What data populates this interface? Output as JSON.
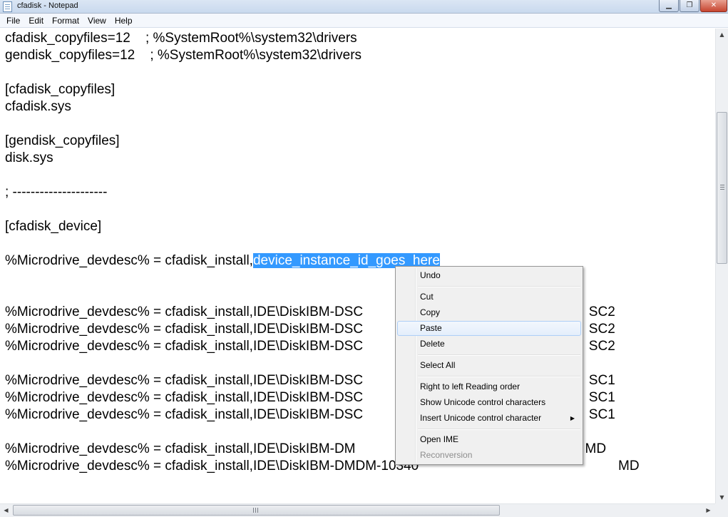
{
  "window": {
    "title": "cfadisk - Notepad",
    "minimize_glyph": "▁",
    "maximize_glyph": "❐",
    "close_glyph": "✕"
  },
  "menubar": {
    "items": [
      "File",
      "Edit",
      "Format",
      "View",
      "Help"
    ]
  },
  "editor": {
    "lines": [
      "cfadisk_copyfiles=12    ; %SystemRoot%\\system32\\drivers",
      "gendisk_copyfiles=12    ; %SystemRoot%\\system32\\drivers",
      "",
      "[cfadisk_copyfiles]",
      "cfadisk.sys",
      "",
      "[gendisk_copyfiles]",
      "disk.sys",
      "",
      "; ---------------------",
      "",
      "[cfadisk_device]",
      "",
      "%Microdrive_devdesc% = cfadisk_install,",
      "",
      "",
      "%Microdrive_devdesc% = cfadisk_install,IDE\\DiskIBM-DSC                                                            SC2",
      "%Microdrive_devdesc% = cfadisk_install,IDE\\DiskIBM-DSC                                                            SC2",
      "%Microdrive_devdesc% = cfadisk_install,IDE\\DiskIBM-DSC                                                            SC2",
      "",
      "%Microdrive_devdesc% = cfadisk_install,IDE\\DiskIBM-DSC                                                            SC1",
      "%Microdrive_devdesc% = cfadisk_install,IDE\\DiskIBM-DSC                                                            SC1",
      "%Microdrive_devdesc% = cfadisk_install,IDE\\DiskIBM-DSC                                                            SC1",
      "",
      "%Microdrive_devdesc% = cfadisk_install,IDE\\DiskIBM-DM                                                             MD",
      "%Microdrive_devdesc% = cfadisk_install,IDE\\DiskIBM-DMDM-10340                                                     MD"
    ],
    "selected_text": "device_instance_id_goes_here"
  },
  "context_menu": {
    "undo": "Undo",
    "cut": "Cut",
    "copy": "Copy",
    "paste": "Paste",
    "delete": "Delete",
    "select_all": "Select All",
    "rtl": "Right to left Reading order",
    "show_unicode": "Show Unicode control characters",
    "insert_unicode": "Insert Unicode control character",
    "open_ime": "Open IME",
    "reconversion": "Reconversion",
    "submenu_glyph": "▶"
  },
  "scrollbars": {
    "up_glyph": "▲",
    "down_glyph": "▼",
    "left_glyph": "◀",
    "right_glyph": "▶"
  }
}
